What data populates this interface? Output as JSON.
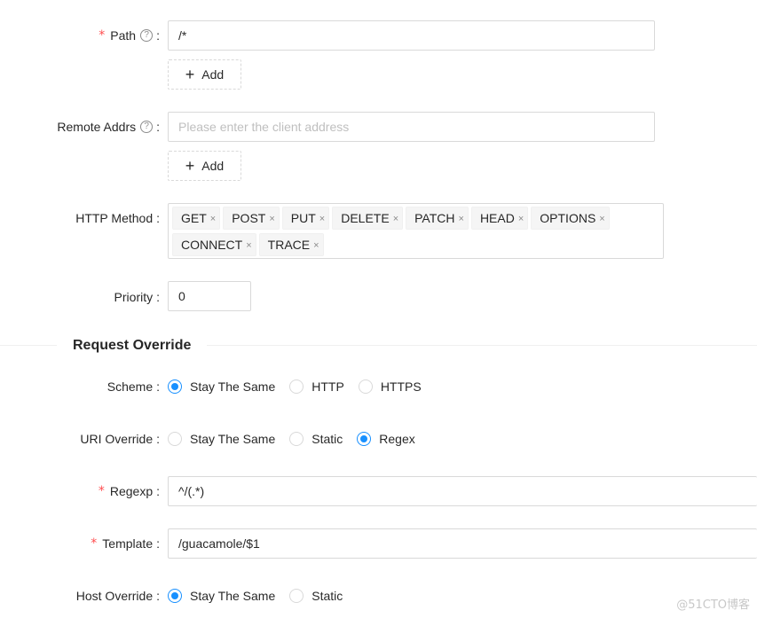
{
  "path": {
    "label": "Path",
    "required_mark": "*",
    "help_icon": "question-circle-icon",
    "value": "/*",
    "add_label": "Add"
  },
  "remote_addrs": {
    "label": "Remote Addrs",
    "help_icon": "question-circle-icon",
    "placeholder": "Please enter the client address",
    "add_label": "Add"
  },
  "http_method": {
    "label": "HTTP Method",
    "selected": [
      "GET",
      "POST",
      "PUT",
      "DELETE",
      "PATCH",
      "HEAD",
      "OPTIONS",
      "CONNECT",
      "TRACE"
    ],
    "remove_glyph": "×"
  },
  "priority": {
    "label": "Priority",
    "value": "0"
  },
  "request_override": {
    "title": "Request Override"
  },
  "scheme": {
    "label": "Scheme",
    "options": [
      "Stay The Same",
      "HTTP",
      "HTTPS"
    ],
    "selected": "Stay The Same"
  },
  "uri_override": {
    "label": "URI Override",
    "options": [
      "Stay The Same",
      "Static",
      "Regex"
    ],
    "selected": "Regex"
  },
  "regexp": {
    "label": "Regexp",
    "required_mark": "*",
    "value": "^/(.*)"
  },
  "template": {
    "label": "Template",
    "required_mark": "*",
    "value": "/guacamole/$1"
  },
  "host_override": {
    "label": "Host Override",
    "options": [
      "Stay The Same",
      "Static"
    ],
    "selected": "Stay The Same"
  },
  "watermark": "@51CTO博客",
  "colors": {
    "primary": "#1890ff",
    "required": "#ff4d4f",
    "border": "#d9d9d9",
    "tag_bg": "#f5f5f5"
  }
}
